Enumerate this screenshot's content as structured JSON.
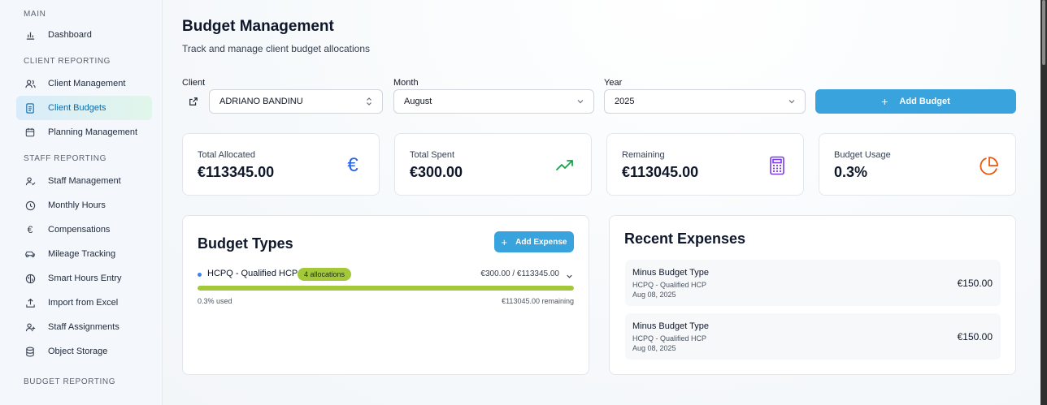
{
  "sidebar": {
    "sections": [
      {
        "label": "MAIN",
        "items": [
          {
            "label": "Dashboard",
            "icon": "bar-chart-icon",
            "active": false
          }
        ]
      },
      {
        "label": "CLIENT REPORTING",
        "items": [
          {
            "label": "Client Management",
            "icon": "users-icon",
            "active": false
          },
          {
            "label": "Client Budgets",
            "icon": "document-icon",
            "active": true
          },
          {
            "label": "Planning Management",
            "icon": "calendar-icon",
            "active": false
          }
        ]
      },
      {
        "label": "STAFF REPORTING",
        "items": [
          {
            "label": "Staff Management",
            "icon": "user-check-icon",
            "active": false
          },
          {
            "label": "Monthly Hours",
            "icon": "clock-icon",
            "active": false
          },
          {
            "label": "Compensations",
            "icon": "euro-icon",
            "active": false
          },
          {
            "label": "Mileage Tracking",
            "icon": "car-icon",
            "active": false
          },
          {
            "label": "Smart Hours Entry",
            "icon": "brain-icon",
            "active": false
          },
          {
            "label": "Import from Excel",
            "icon": "upload-icon",
            "active": false
          },
          {
            "label": "Staff Assignments",
            "icon": "user-plus-icon",
            "active": false
          },
          {
            "label": "Object Storage",
            "icon": "database-icon",
            "active": false
          }
        ]
      },
      {
        "label": "BUDGET REPORTING",
        "items": []
      }
    ]
  },
  "header": {
    "title": "Budget Management",
    "subtitle": "Track and manage client budget allocations"
  },
  "filters": {
    "client_label": "Client",
    "client_value": "ADRIANO BANDINU",
    "month_label": "Month",
    "month_value": "August",
    "year_label": "Year",
    "year_value": "2025",
    "add_budget_label": "Add Budget"
  },
  "stats": [
    {
      "label": "Total Allocated",
      "value": "€113345.00",
      "icon": "euro-icon",
      "color": "#2563eb"
    },
    {
      "label": "Total Spent",
      "value": "€300.00",
      "icon": "trending-up-icon",
      "color": "#16a34a"
    },
    {
      "label": "Remaining",
      "value": "€113045.00",
      "icon": "calculator-icon",
      "color": "#7c3aed"
    },
    {
      "label": "Budget Usage",
      "value": "0.3%",
      "icon": "pie-chart-icon",
      "color": "#ea580c"
    }
  ],
  "budget_types": {
    "title": "Budget Types",
    "add_expense_label": "Add Expense",
    "items": [
      {
        "name": "HCPQ - Qualified HCP",
        "badge": "4 allocations",
        "amount": "€300.00 / €113345.00",
        "usage_fraction": 1.0,
        "used_text": "0.3% used",
        "remaining_text": "€113045.00 remaining"
      }
    ]
  },
  "recent_expenses": {
    "title": "Recent Expenses",
    "items": [
      {
        "type": "Minus Budget Type",
        "name": "HCPQ - Qualified HCP",
        "date": "Aug 08, 2025",
        "amount": "€150.00"
      },
      {
        "type": "Minus Budget Type",
        "name": "HCPQ - Qualified HCP",
        "date": "Aug 08, 2025",
        "amount": "€150.00"
      }
    ]
  },
  "colors": {
    "accent": "#38a3dc",
    "progress": "#a3c93a",
    "active_nav_text": "#0b6aa8"
  }
}
